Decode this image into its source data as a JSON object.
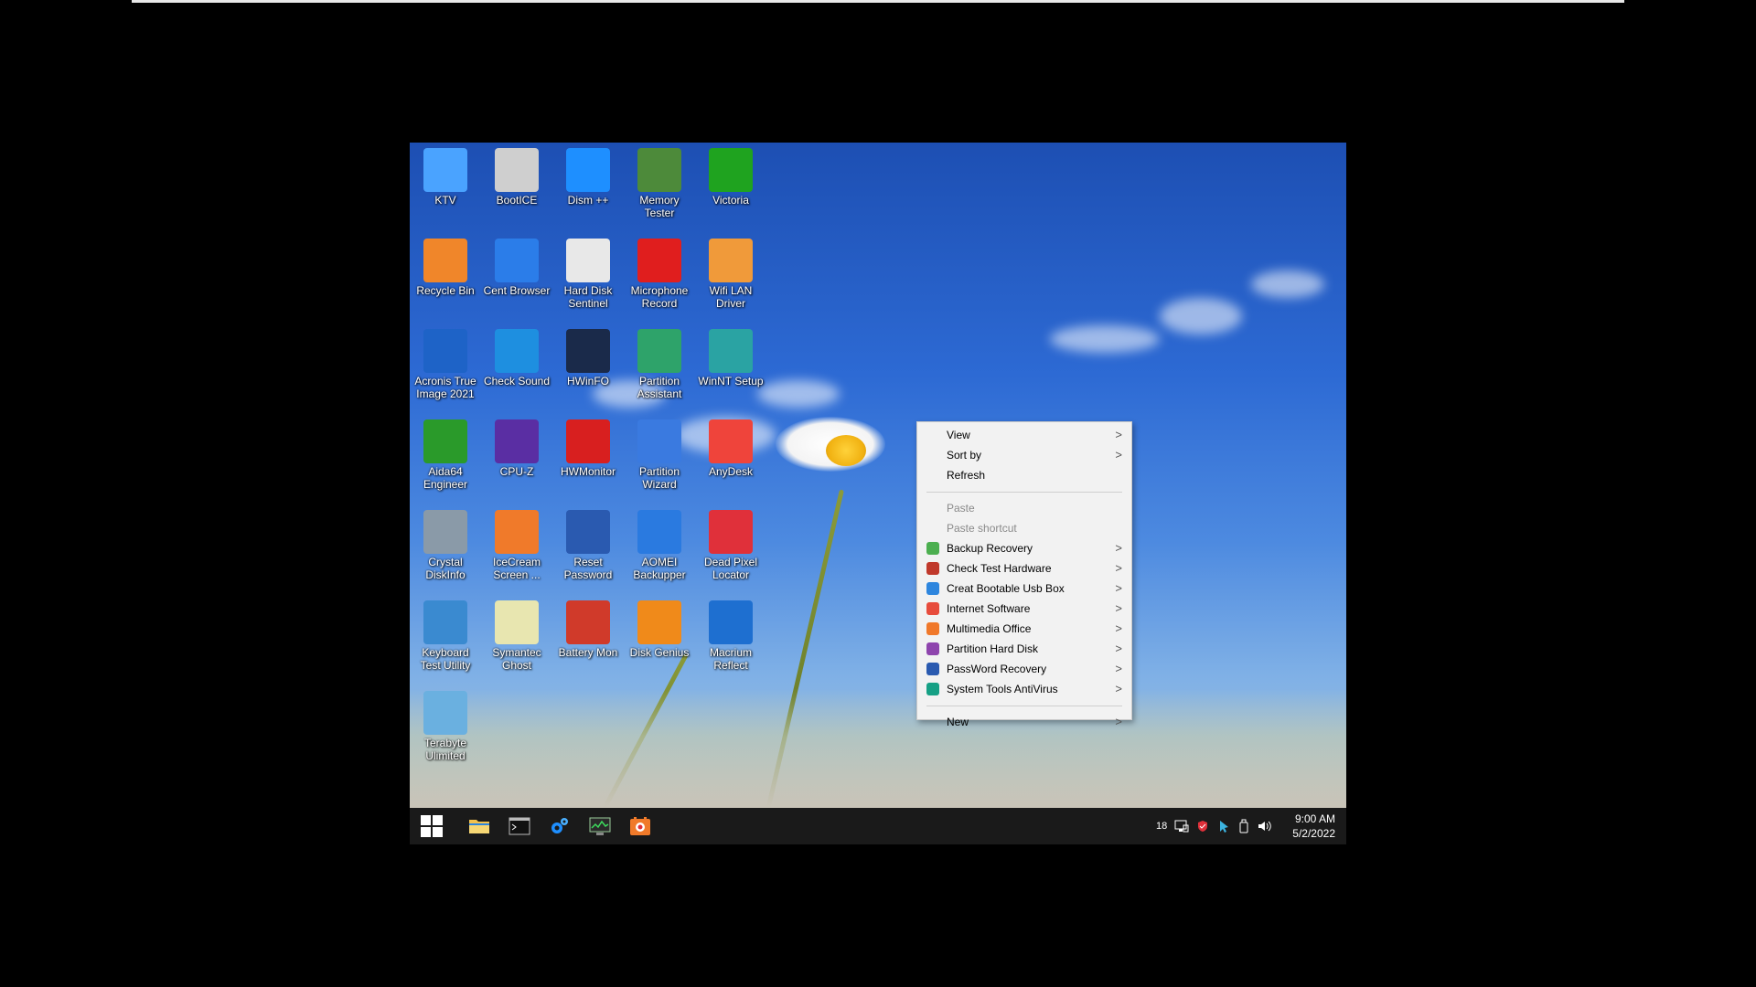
{
  "desktop": {
    "icons": [
      {
        "label": "KTV",
        "icon": "monitor-icon",
        "color": "#4aa3ff"
      },
      {
        "label": "BootICE",
        "icon": "floppy-icon",
        "color": "#cfcfcf"
      },
      {
        "label": "Dism ++",
        "icon": "gears-icon",
        "color": "#1e8fff"
      },
      {
        "label": "Memory Tester",
        "icon": "ram-icon",
        "color": "#4d8a3a"
      },
      {
        "label": "Victoria",
        "icon": "plus-icon",
        "color": "#1fa31f"
      },
      {
        "label": "Recycle Bin",
        "icon": "recycle-bin-icon",
        "color": "#f0862a"
      },
      {
        "label": "Cent Browser",
        "icon": "browser-icon",
        "color": "#2b7de9"
      },
      {
        "label": "Hard Disk Sentinel",
        "icon": "disk-sentinel-icon",
        "color": "#e8e8e8"
      },
      {
        "label": "Microphone Record",
        "icon": "microphone-icon",
        "color": "#e01e1e"
      },
      {
        "label": "Wifi LAN Driver",
        "icon": "wifi-icon",
        "color": "#f09a3a"
      },
      {
        "label": "Acronis True Image 2021",
        "icon": "acronis-icon",
        "color": "#1e63c7"
      },
      {
        "label": "Check Sound",
        "icon": "speaker-mute-icon",
        "color": "#1e8fe0"
      },
      {
        "label": "HWinFO",
        "icon": "hwinfo-icon",
        "color": "#1a2a4a"
      },
      {
        "label": "Partition Assistant",
        "icon": "partition-assistant-icon",
        "color": "#2ea36a"
      },
      {
        "label": "WinNT Setup",
        "icon": "winnt-icon",
        "color": "#2aa3a3"
      },
      {
        "label": "Aida64 Engineer",
        "icon": "aida64-icon",
        "color": "#2a9a2a"
      },
      {
        "label": "CPU-Z",
        "icon": "cpu-icon",
        "color": "#5a2ea3"
      },
      {
        "label": "HWMonitor",
        "icon": "hwmonitor-icon",
        "color": "#d81f1f"
      },
      {
        "label": "Partition Wizard",
        "icon": "wand-icon",
        "color": "#3a7ae0"
      },
      {
        "label": "AnyDesk",
        "icon": "anydesk-icon",
        "color": "#ef443b"
      },
      {
        "label": "Crystal DiskInfo",
        "icon": "crystal-icon",
        "color": "#8a9aa8"
      },
      {
        "label": "IceCream Screen ...",
        "icon": "screen-recorder-icon",
        "color": "#f07a2a"
      },
      {
        "label": "Reset Password",
        "icon": "lock-key-icon",
        "color": "#2a5ab0"
      },
      {
        "label": "AOMEI Backupper",
        "icon": "aomei-icon",
        "color": "#2a7ae0"
      },
      {
        "label": "Dead Pixel Locator",
        "icon": "dead-pixel-icon",
        "color": "#e0303a"
      },
      {
        "label": "Keyboard Test Utility",
        "icon": "keyboard-icon",
        "color": "#3a8ad0"
      },
      {
        "label": "Symantec Ghost",
        "icon": "ghost-icon",
        "color": "#e8e6b0"
      },
      {
        "label": "Battery Mon",
        "icon": "battery-icon",
        "color": "#d03a2a"
      },
      {
        "label": "Disk Genius",
        "icon": "disk-genius-icon",
        "color": "#f08a1a"
      },
      {
        "label": "Macrium Reflect",
        "icon": "macrium-icon",
        "color": "#1e6fd0"
      },
      {
        "label": "Terabyte Ulimited",
        "icon": "terabyte-icon",
        "color": "#6ab0e0"
      }
    ]
  },
  "context_menu": {
    "items": [
      {
        "label": "View",
        "submenu": true,
        "disabled": false
      },
      {
        "label": "Sort by",
        "submenu": true,
        "disabled": false
      },
      {
        "label": "Refresh",
        "submenu": false,
        "disabled": false
      },
      {
        "separator": true
      },
      {
        "label": "Paste",
        "submenu": false,
        "disabled": true
      },
      {
        "label": "Paste shortcut",
        "submenu": false,
        "disabled": true
      },
      {
        "label": "Backup Recovery",
        "submenu": true,
        "disabled": false,
        "icon": "backup-icon",
        "color": "#4caf50"
      },
      {
        "label": "Check Test Hardware",
        "submenu": true,
        "disabled": false,
        "icon": "hardware-icon",
        "color": "#c0392b"
      },
      {
        "label": "Creat Bootable Usb Box",
        "submenu": true,
        "disabled": false,
        "icon": "usb-box-icon",
        "color": "#2e86de"
      },
      {
        "label": "Internet Software",
        "submenu": true,
        "disabled": false,
        "icon": "internet-icon",
        "color": "#e74c3c"
      },
      {
        "label": "Multimedia Office",
        "submenu": true,
        "disabled": false,
        "icon": "multimedia-icon",
        "color": "#f0782a"
      },
      {
        "label": "Partition Hard Disk",
        "submenu": true,
        "disabled": false,
        "icon": "partition-icon",
        "color": "#8e44ad"
      },
      {
        "label": "PassWord Recovery",
        "submenu": true,
        "disabled": false,
        "icon": "password-icon",
        "color": "#2a5ab0"
      },
      {
        "label": "System Tools AntiVirus",
        "submenu": true,
        "disabled": false,
        "icon": "antivirus-icon",
        "color": "#16a085"
      },
      {
        "separator": true
      },
      {
        "label": "New",
        "submenu": true,
        "disabled": false
      }
    ],
    "submenu_arrow": ">"
  },
  "taskbar": {
    "pinned": [
      {
        "name": "start-button",
        "icon": "windows-logo-icon"
      },
      {
        "name": "file-explorer",
        "icon": "folder-icon"
      },
      {
        "name": "command-prompt",
        "icon": "terminal-icon"
      },
      {
        "name": "dism-tool",
        "icon": "gears-icon"
      },
      {
        "name": "task-manager",
        "icon": "chart-monitor-icon"
      },
      {
        "name": "media-app",
        "icon": "media-icon"
      }
    ],
    "tray": {
      "badge_count": "18",
      "icons": [
        "network-icon",
        "security-icon",
        "cursor-icon",
        "usb-icon",
        "volume-icon"
      ]
    },
    "clock": {
      "time": "9:00 AM",
      "date": "5/2/2022"
    }
  },
  "colors": {
    "taskbar_bg": "#1a1a1a",
    "menu_bg": "#f2f2f2",
    "sky_top": "#1d4fb3"
  }
}
